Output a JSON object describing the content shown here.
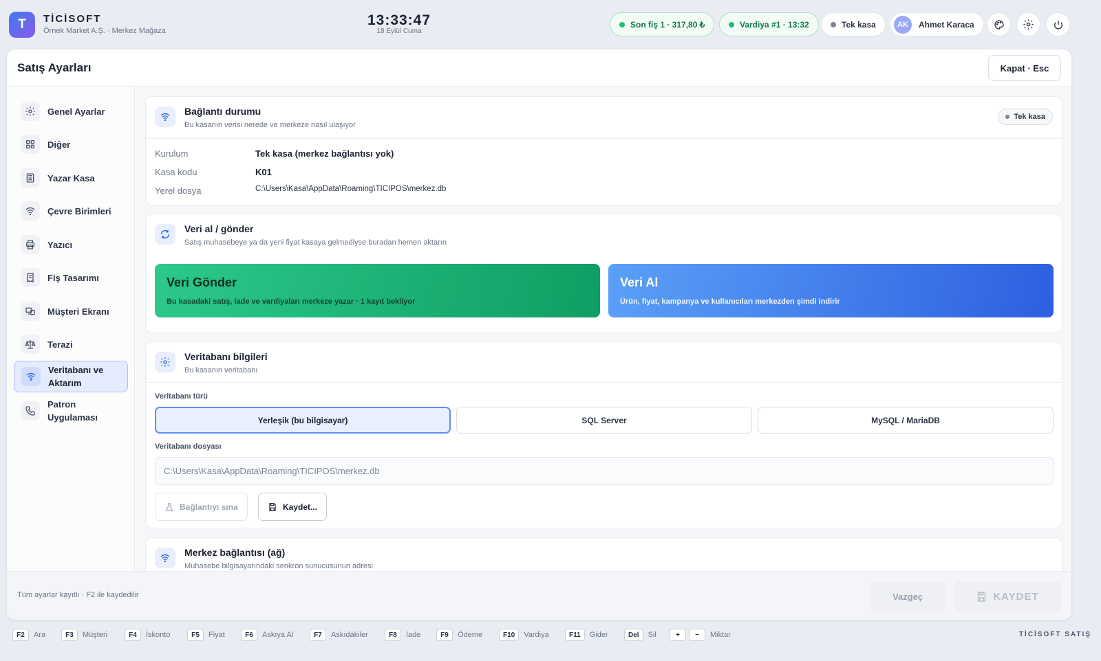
{
  "app": {
    "logo_letter": "T",
    "brand": "TİCİSOFT",
    "company": "Örnek Market A.Ş. · Merkez Mağaza"
  },
  "clock": {
    "time": "13:33:47",
    "date": "18 Eylül Cuma"
  },
  "status": {
    "last_receipt": "Son fiş 1 · 317,80 ₺",
    "shift": "Vardiya #1 · 13:32",
    "mode": "Tek kasa",
    "user_initials": "AK",
    "user_name": "Ahmet Karaca"
  },
  "panel": {
    "title": "Satış Ayarları",
    "close_label": "Kapat · Esc"
  },
  "sidebar": {
    "items": [
      {
        "label": "Genel Ayarlar",
        "icon": "gear-icon"
      },
      {
        "label": "Diğer",
        "icon": "grid-icon"
      },
      {
        "label": "Yazar Kasa",
        "icon": "register-icon"
      },
      {
        "label": "Çevre Birimleri",
        "icon": "wifi-icon"
      },
      {
        "label": "Yazıcı",
        "icon": "printer-icon"
      },
      {
        "label": "Fiş Tasarımı",
        "icon": "receipt-icon"
      },
      {
        "label": "Müşteri Ekranı",
        "icon": "display-icon"
      },
      {
        "label": "Terazi",
        "icon": "scale-icon"
      },
      {
        "label": "Veritabanı ve Aktarım",
        "icon": "wifi-icon",
        "active": true
      },
      {
        "label": "Patron Uygulaması",
        "icon": "phone-icon"
      }
    ]
  },
  "connection": {
    "title": "Bağlantı durumu",
    "subtitle": "Bu kasanın verisi nerede ve merkeze nasıl ulaşıyor",
    "badge": "Tek kasa",
    "rows": [
      {
        "label": "Kurulum",
        "value": "Tek kasa (merkez bağlantısı yok)"
      },
      {
        "label": "Kasa kodu",
        "value": "K01"
      },
      {
        "label": "Yerel dosya",
        "value": "C:\\Users\\Kasa\\AppData\\Roaming\\TICIPOS\\merkez.db"
      }
    ]
  },
  "transfer": {
    "title": "Veri al / gönder",
    "subtitle": "Satış muhasebeye ya da yeni fiyat kasaya gelmediyse buradan hemen aktarın",
    "send_title": "Veri Gönder",
    "send_desc": "Bu kasadaki satış, iade ve vardiyaları merkeze yazar · 1 kayıt bekliyor",
    "receive_title": "Veri Al",
    "receive_desc": "Ürün, fiyat, kampanya ve kullanıcıları merkezden şimdi indirir"
  },
  "database": {
    "title": "Veritabanı bilgileri",
    "subtitle": "Bu kasanın veritabanı",
    "type_label": "Veritabanı türü",
    "types": [
      "Yerleşik (bu bilgisayar)",
      "SQL Server",
      "MySQL / MariaDB"
    ],
    "selected_type": "Yerleşik (bu bilgisayar)",
    "file_label": "Veritabanı dosyası",
    "file_value": "C:\\Users\\Kasa\\AppData\\Roaming\\TICIPOS\\merkez.db",
    "test_label": "Bağlantıyı sına",
    "save_label": "Kaydet..."
  },
  "network": {
    "title": "Merkez bağlantısı (ağ)",
    "subtitle": "Muhasebe bilgisayarındaki senkron sunucusunun adresi"
  },
  "footer": {
    "note": "Tüm ayarlar kayıtlı · F2 ile kaydedilir",
    "cancel": "Vazgeç",
    "save": "KAYDET"
  },
  "shortcuts": [
    {
      "key": "F2",
      "label": "Ara"
    },
    {
      "key": "F3",
      "label": "Müşteri"
    },
    {
      "key": "F4",
      "label": "İskonto"
    },
    {
      "key": "F5",
      "label": "Fiyat"
    },
    {
      "key": "F6",
      "label": "Askıya Al"
    },
    {
      "key": "F7",
      "label": "Askıdakiler"
    },
    {
      "key": "F8",
      "label": "İade"
    },
    {
      "key": "F9",
      "label": "Ödeme"
    },
    {
      "key": "F10",
      "label": "Vardiya"
    },
    {
      "key": "F11",
      "label": "Gider"
    },
    {
      "key": "Del",
      "label": "Sil"
    },
    {
      "key": "+",
      "key2": "−",
      "label": "Miktar"
    }
  ],
  "shortcut_brand": "TİCİSOFT SATIŞ",
  "colors": {
    "accent": "#2d5fe0",
    "success": "#1fbf74",
    "send_button": "#1fbf74",
    "receive_button": "#3b7cf0"
  }
}
